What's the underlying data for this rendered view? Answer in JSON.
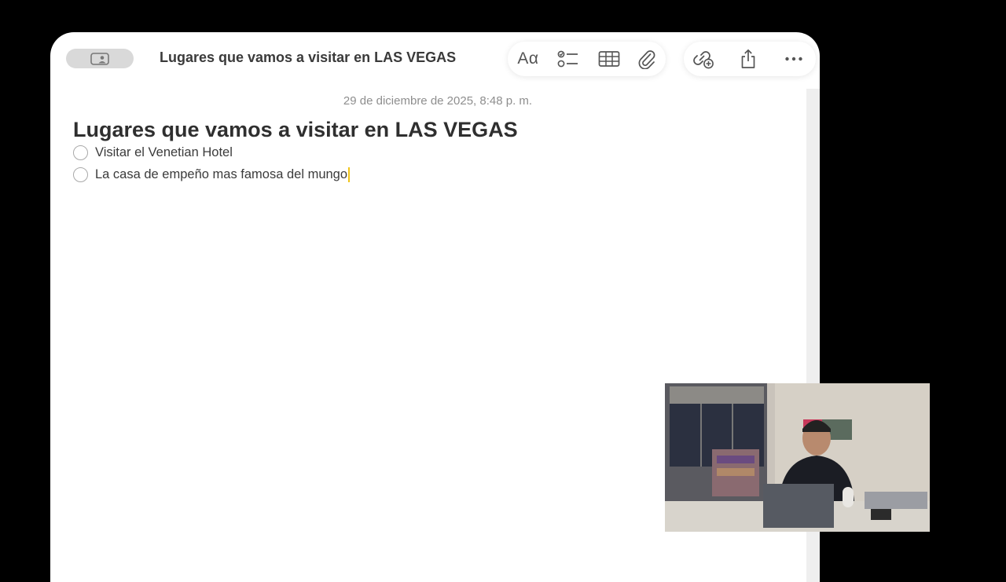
{
  "window": {
    "title": "Lugares que vamos a visitar en LAS VEGAS"
  },
  "toolbar": {
    "format_label": "Aα",
    "tools": [
      "checklist-icon",
      "table-icon",
      "attachment-icon",
      "collaborate-icon",
      "share-icon",
      "more-icon"
    ]
  },
  "note": {
    "date": "29 de diciembre de 2025, 8:48 p. m.",
    "heading": "Lugares que vamos a visitar en LAS VEGAS",
    "checklist": [
      {
        "text": "Visitar el Venetian Hotel",
        "checked": false
      },
      {
        "text": "La casa de empeño mas famosa del mungo",
        "checked": false
      }
    ]
  },
  "colors": {
    "background": "#000000",
    "window": "#ffffff",
    "caret": "#f0c419"
  }
}
